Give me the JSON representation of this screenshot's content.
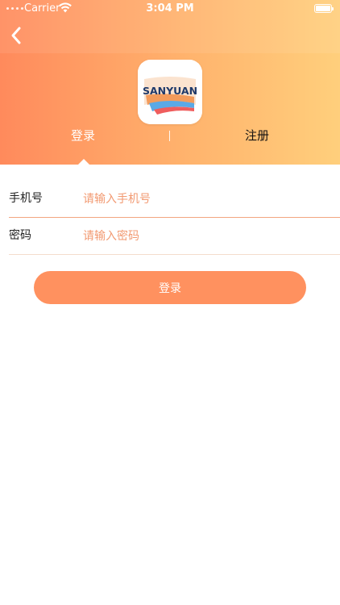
{
  "status_bar": {
    "carrier": "Carrier",
    "time": "3:04 PM"
  },
  "nav": {
    "back_icon": "chevron-left-icon"
  },
  "logo": {
    "text": "SANYUAN",
    "colors": {
      "text": "#1f3a6b",
      "band_top": "#f39b5b",
      "band_bottom": "#5aa9e6",
      "accent": "#ef5d5d"
    }
  },
  "tabs": {
    "login": "登录",
    "register": "注册",
    "active": "login"
  },
  "form": {
    "phone_label": "手机号",
    "phone_placeholder": "请输入手机号",
    "phone_value": "",
    "password_label": "密码",
    "password_placeholder": "请输入密码",
    "password_value": ""
  },
  "login_button": {
    "label": "登录"
  },
  "theme": {
    "gradient_start": "#ff8a5c",
    "gradient_end": "#ffcf7c",
    "accent": "#ff915f",
    "placeholder": "#f29a72"
  }
}
